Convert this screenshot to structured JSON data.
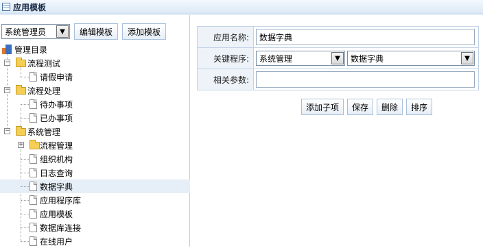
{
  "window": {
    "title": "应用模板"
  },
  "toolbar": {
    "user_select_value": "系统管理员",
    "edit_button": "编辑模板",
    "add_button": "添加模板"
  },
  "tree": {
    "root": "管理目录",
    "groups": [
      {
        "label": "流程测试",
        "expanded": true,
        "children": [
          "请假申请"
        ]
      },
      {
        "label": "流程处理",
        "expanded": true,
        "children": [
          "待办事项",
          "已办事项"
        ]
      },
      {
        "label": "系统管理",
        "expanded": true,
        "children": [
          "流程管理",
          "组织机构",
          "日志查询",
          "数据字典",
          "应用程序库",
          "应用模板",
          "数据库连接",
          "在线用户"
        ],
        "collapsed_child": "流程管理",
        "selected": "数据字典"
      }
    ]
  },
  "form": {
    "name_label": "应用名称:",
    "name_value": "数据字典",
    "program_label": "关键程序:",
    "program_select_1": "系统管理",
    "program_select_2": "数据字典",
    "params_label": "相关参数:",
    "params_value": ""
  },
  "actions": {
    "add_child": "添加子项",
    "save": "保存",
    "delete": "删除",
    "sort": "排序"
  },
  "colors": {
    "titlebar_bg": "#dbe8f6",
    "selected_row": "#e6eef8",
    "form_label_bg": "#eef3f9",
    "border": "#c3d3e6"
  }
}
